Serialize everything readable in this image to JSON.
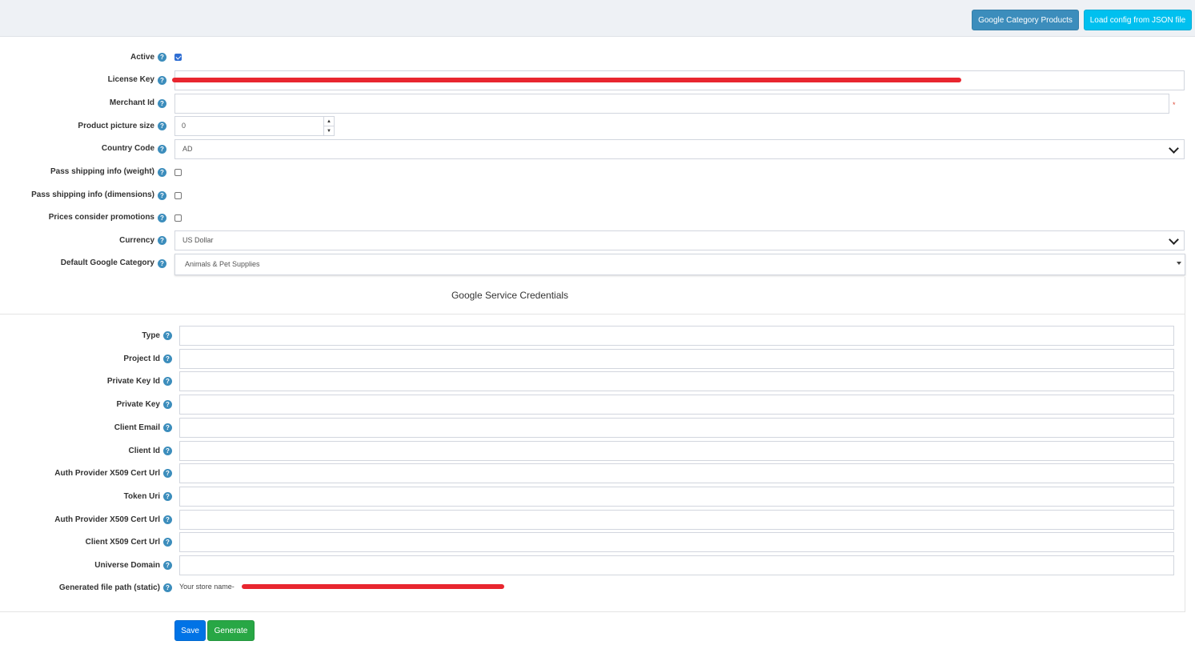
{
  "toolbar": {
    "google_category_products": "Google Category Products",
    "load_config_json": "Load config from JSON file"
  },
  "help_glyph": "?",
  "settings": {
    "active": {
      "label": "Active",
      "checked": true
    },
    "license_key": {
      "label": "License Key",
      "value": ""
    },
    "merchant_id": {
      "label": "Merchant Id",
      "value": "",
      "required_mark": "*"
    },
    "product_picture_size": {
      "label": "Product picture size",
      "value": "0"
    },
    "country_code": {
      "label": "Country Code",
      "value": "AD"
    },
    "pass_shipping_weight": {
      "label": "Pass shipping info (weight)",
      "checked": false
    },
    "pass_shipping_dimensions": {
      "label": "Pass shipping info (dimensions)",
      "checked": false
    },
    "prices_consider_promotions": {
      "label": "Prices consider promotions",
      "checked": false
    },
    "currency": {
      "label": "Currency",
      "value": "US Dollar"
    },
    "default_google_category": {
      "label": "Default Google Category",
      "value": "Animals & Pet Supplies"
    }
  },
  "credentials": {
    "title": "Google Service Credentials",
    "fields": [
      {
        "label": "Type",
        "value": ""
      },
      {
        "label": "Project Id",
        "value": ""
      },
      {
        "label": "Private Key Id",
        "value": ""
      },
      {
        "label": "Private Key",
        "value": ""
      },
      {
        "label": "Client Email",
        "value": ""
      },
      {
        "label": "Client Id",
        "value": ""
      },
      {
        "label": "Auth Provider X509 Cert Url",
        "value": ""
      },
      {
        "label": "Token Uri",
        "value": ""
      },
      {
        "label": "Auth Provider X509 Cert Url",
        "value": ""
      },
      {
        "label": "Client X509 Cert Url",
        "value": ""
      },
      {
        "label": "Universe Domain",
        "value": ""
      }
    ],
    "generated_path": {
      "label": "Generated file path (static)",
      "value": "Your store name-"
    }
  },
  "actions": {
    "save": "Save",
    "generate": "Generate"
  },
  "colors": {
    "primary": "#3c8dbc",
    "info": "#00c0ef",
    "save": "#0073e6",
    "generate": "#28a745",
    "redaction": "#e8262f"
  }
}
